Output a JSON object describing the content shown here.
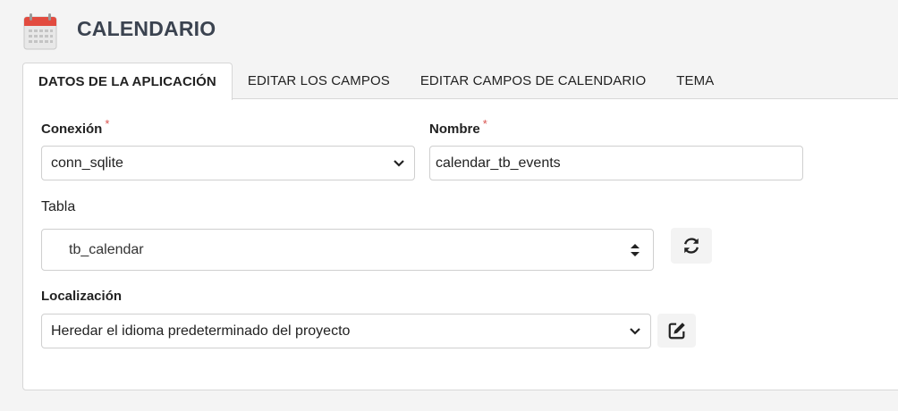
{
  "header": {
    "title": "CALENDARIO",
    "icon": "calendar-icon"
  },
  "tabs": [
    {
      "label": "DATOS DE LA APLICACIÓN",
      "active": true
    },
    {
      "label": "EDITAR LOS CAMPOS",
      "active": false
    },
    {
      "label": "EDITAR CAMPOS DE CALENDARIO",
      "active": false
    },
    {
      "label": "TEMA",
      "active": false
    }
  ],
  "form": {
    "connection": {
      "label": "Conexión",
      "required_mark": "*",
      "value": "conn_sqlite"
    },
    "name": {
      "label": "Nombre",
      "required_mark": "*",
      "value": "calendar_tb_events"
    },
    "table": {
      "label": "Tabla",
      "value": "tb_calendar",
      "refresh_icon": "refresh-icon"
    },
    "localization": {
      "label": "Localización",
      "value": "Heredar el idioma predeterminado del proyecto",
      "edit_icon": "edit-icon"
    }
  },
  "colors": {
    "required": "#d9534f",
    "title": "#3b4350",
    "calendar_red": "#e24b3f"
  }
}
